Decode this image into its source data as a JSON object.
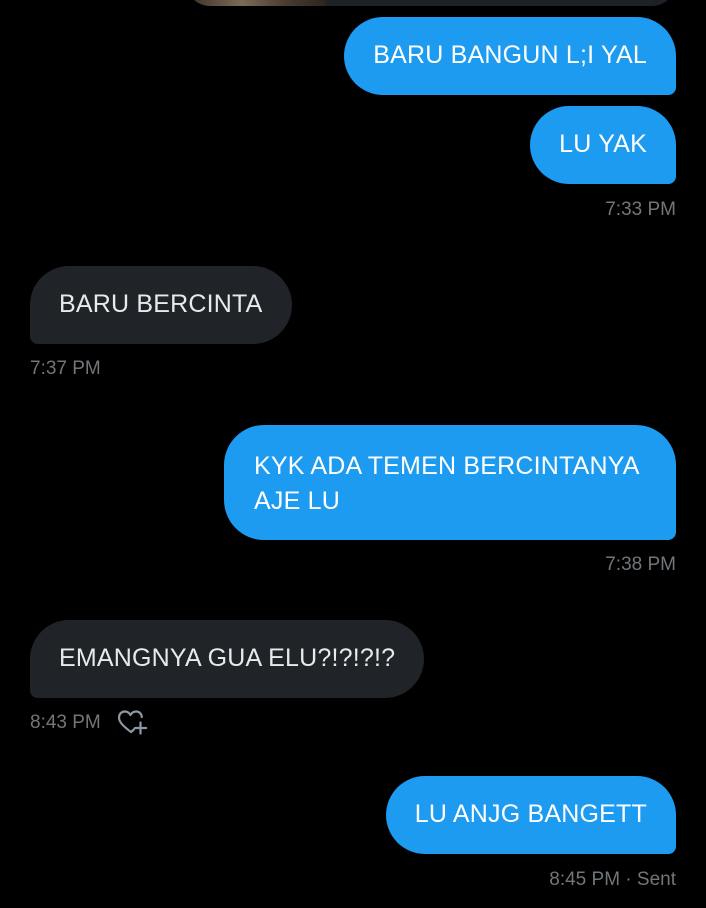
{
  "messages": [
    {
      "id": "m1",
      "direction": "out",
      "text": "BARU BANGUN L;I YAL"
    },
    {
      "id": "m2",
      "direction": "out",
      "text": "LU YAK"
    },
    {
      "id": "m3",
      "direction": "in",
      "text": "BARU BERCINTA"
    },
    {
      "id": "m4",
      "direction": "out",
      "text": "KYK ADA TEMEN BERCINTANYA AJE LU"
    },
    {
      "id": "m5",
      "direction": "in",
      "text": "EMANGNYA GUA ELU?!?!?!?"
    },
    {
      "id": "m6",
      "direction": "out",
      "text": "LU ANJG BANGETT"
    }
  ],
  "timestamps": {
    "t1": "7:33 PM",
    "t2": "7:37 PM",
    "t3": "7:38 PM",
    "t4": "8:43 PM",
    "t5": "8:45 PM · Sent"
  },
  "icons": {
    "react": "heart-plus-icon"
  },
  "colors": {
    "background": "#000000",
    "outgoing_bubble": "#1d9bf0",
    "incoming_bubble": "#202327",
    "meta_text": "#71767b"
  }
}
